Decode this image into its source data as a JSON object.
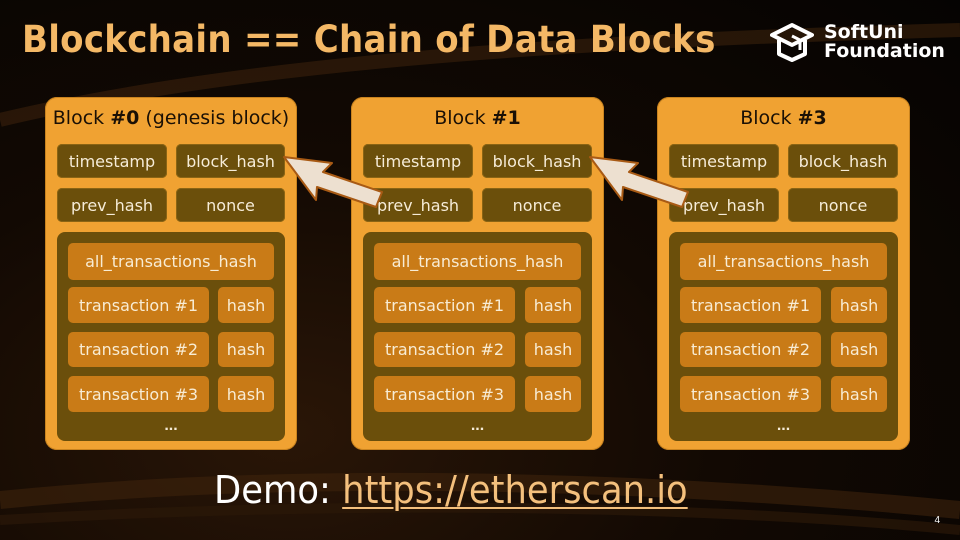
{
  "slide": {
    "title": "Blockchain == Chain of Data Blocks",
    "logo": {
      "icon": "graduation-cap-icon",
      "line1": "SoftUni",
      "line2": "Foundation"
    },
    "page_number": "4",
    "demo": {
      "label": "Demo:",
      "link_text": "https://etherscan.io"
    }
  },
  "colors": {
    "title": "#f4b866",
    "block_bg": "#f0a232",
    "header_cell_bg": "#6b4f0b",
    "transaction_cell_bg": "#c97b17",
    "arrow_fill": "#ede0d0",
    "arrow_stroke": "#a85a14"
  },
  "blocks": [
    {
      "title_prefix": "Block ",
      "title_number": "#0",
      "title_suffix": " (genesis block)",
      "fields": {
        "timestamp": "timestamp",
        "block_hash": "block_hash",
        "prev_hash": "prev_hash",
        "nonce": "nonce"
      },
      "all_transactions_hash": "all_transactions_hash",
      "transactions": [
        {
          "name": "transaction #1",
          "hash": "hash"
        },
        {
          "name": "transaction #2",
          "hash": "hash"
        },
        {
          "name": "transaction #3",
          "hash": "hash"
        }
      ],
      "more": "..."
    },
    {
      "title_prefix": "Block ",
      "title_number": "#1",
      "title_suffix": "",
      "fields": {
        "timestamp": "timestamp",
        "block_hash": "block_hash",
        "prev_hash": "prev_hash",
        "nonce": "nonce"
      },
      "all_transactions_hash": "all_transactions_hash",
      "transactions": [
        {
          "name": "transaction #1",
          "hash": "hash"
        },
        {
          "name": "transaction #2",
          "hash": "hash"
        },
        {
          "name": "transaction #3",
          "hash": "hash"
        }
      ],
      "more": "..."
    },
    {
      "title_prefix": "Block ",
      "title_number": "#3",
      "title_suffix": "",
      "fields": {
        "timestamp": "timestamp",
        "block_hash": "block_hash",
        "prev_hash": "prev_hash",
        "nonce": "nonce"
      },
      "all_transactions_hash": "all_transactions_hash",
      "transactions": [
        {
          "name": "transaction #1",
          "hash": "hash"
        },
        {
          "name": "transaction #2",
          "hash": "hash"
        },
        {
          "name": "transaction #3",
          "hash": "hash"
        }
      ],
      "more": "..."
    }
  ],
  "links": [
    {
      "from": "Block #1 prev_hash",
      "to": "Block #0 block_hash"
    },
    {
      "from": "Block #3 prev_hash",
      "to": "Block #1 block_hash"
    }
  ]
}
